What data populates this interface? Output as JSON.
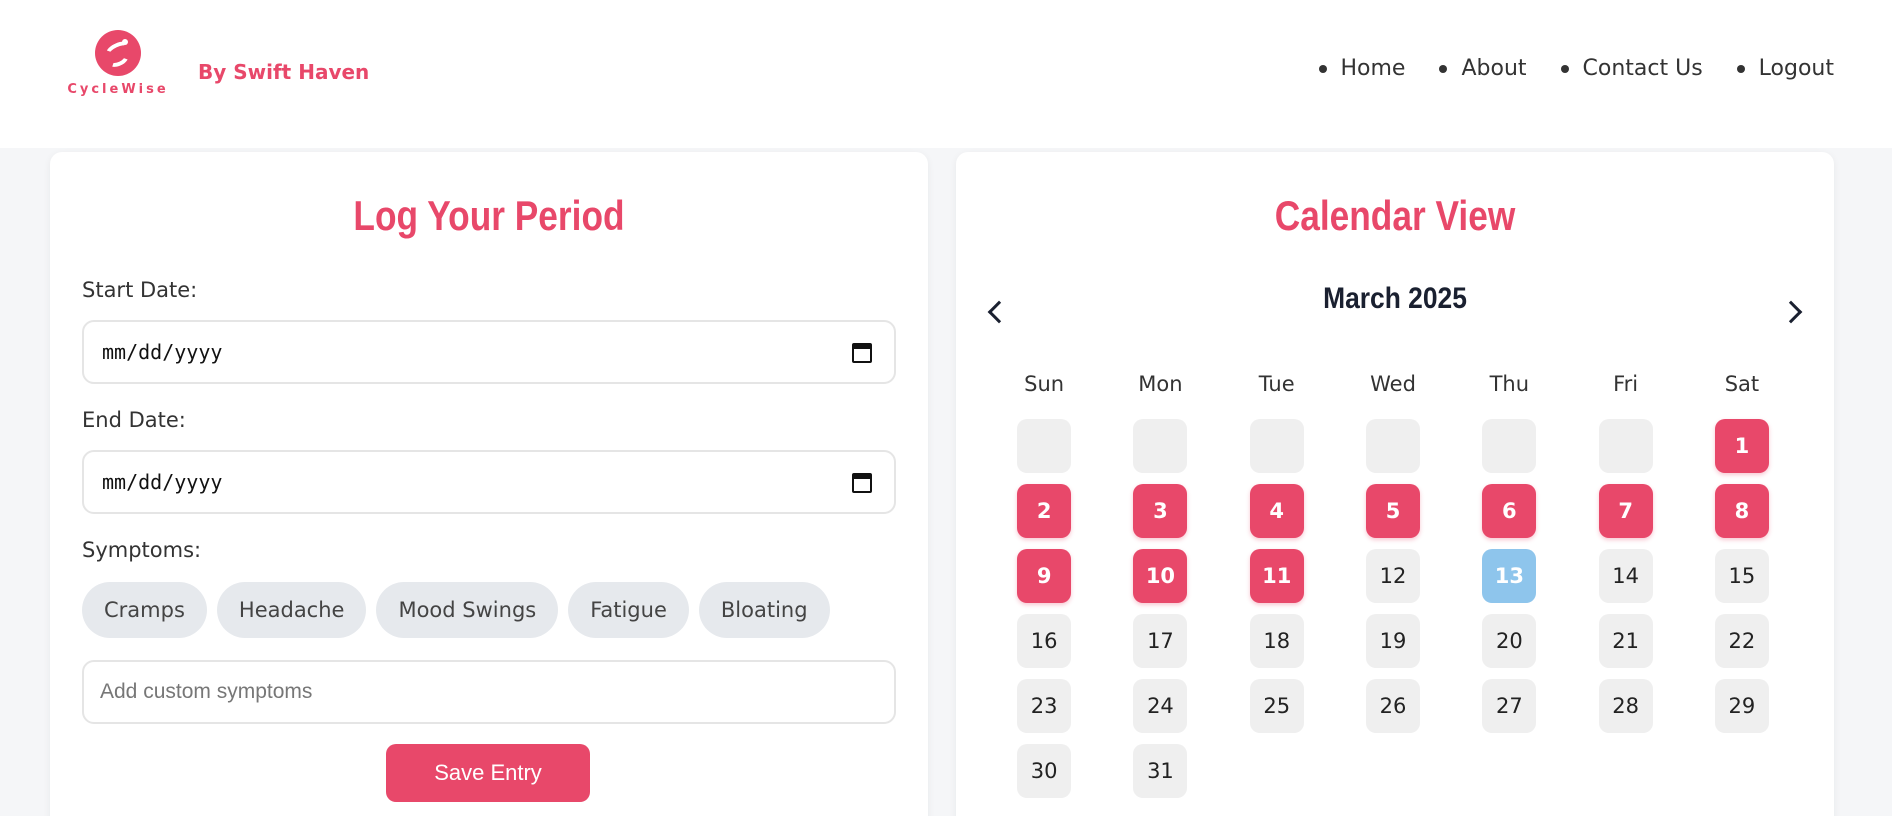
{
  "header": {
    "logo_text": "CycleWise",
    "byline": "By Swift Haven",
    "nav": [
      "Home",
      "About",
      "Contact Us",
      "Logout"
    ]
  },
  "log_form": {
    "title": "Log Your Period",
    "start_label": "Start Date:",
    "start_value": "mm/dd/yyyy",
    "end_label": "End Date:",
    "end_value": "mm/dd/yyyy",
    "symptoms_label": "Symptoms:",
    "symptoms": [
      "Cramps",
      "Headache",
      "Mood Swings",
      "Fatigue",
      "Bloating"
    ],
    "custom_placeholder": "Add custom symptoms",
    "save_label": "Save Entry"
  },
  "calendar": {
    "title": "Calendar View",
    "month": "March 2025",
    "weekdays": [
      "Sun",
      "Mon",
      "Tue",
      "Wed",
      "Thu",
      "Fri",
      "Sat"
    ],
    "leading_blanks": 6,
    "days_in_month": 31,
    "period_days": [
      1,
      2,
      3,
      4,
      5,
      6,
      7,
      8,
      9,
      10,
      11
    ],
    "today": 13
  },
  "colors": {
    "accent": "#e8486a",
    "today": "#8ec5ec",
    "day_bg": "#efefef",
    "chip_bg": "#e6e9ed"
  }
}
